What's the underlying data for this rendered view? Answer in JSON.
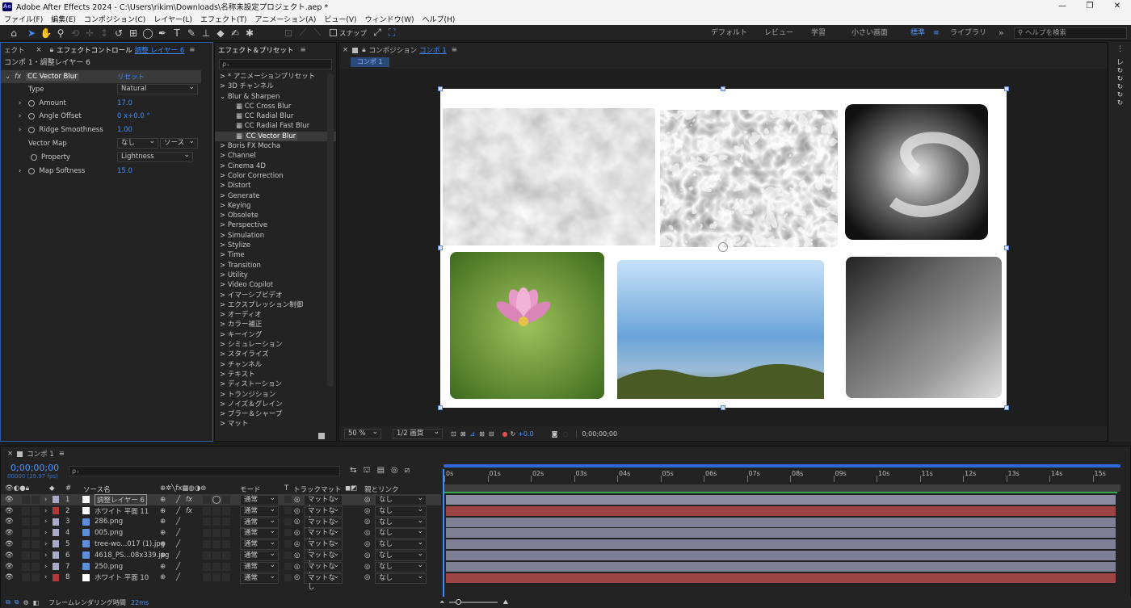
{
  "window": {
    "title": "Adobe After Effects 2024 - C:\\Users\\rikim\\Downloads\\名称未設定プロジェクト.aep *",
    "app_icon": "Ae",
    "min": "—",
    "max": "❐",
    "close": "✕"
  },
  "menu": [
    "ファイル(F)",
    "編集(E)",
    "コンポジション(C)",
    "レイヤー(L)",
    "エフェクト(T)",
    "アニメーション(A)",
    "ビュー(V)",
    "ウィンドウ(W)",
    "ヘルプ(H)"
  ],
  "toolbar": {
    "snap_label": "スナップ",
    "workspaces": [
      "デフォルト",
      "レビュー",
      "学習",
      "小さい画面",
      "標準",
      "ライブラリ"
    ],
    "active_workspace": "標準",
    "more": "»",
    "help_placeholder": "ヘルプを検索"
  },
  "effect_controls": {
    "tab_prev": "ェクト",
    "tab_label": "エフェクトコントロール",
    "tab_layer": "調整 レイヤー 6",
    "subheader": "コンポ 1・調整レイヤー 6",
    "effect_name": "CC Vector Blur",
    "reset": "リセット",
    "type_label": "Type",
    "type_value": "Natural",
    "amount_label": "Amount",
    "amount_value": "17.0",
    "angle_label": "Angle Offset",
    "angle_value": "0 x+0.0 °",
    "ridge_label": "Ridge Smoothness",
    "ridge_value": "1.00",
    "vmap_label": "Vector Map",
    "vmap_value": "なし",
    "vmap_source": "ソース",
    "property_label": "Property",
    "property_value": "Lightness",
    "softness_label": "Map Softness",
    "softness_value": "15.0"
  },
  "presets": {
    "tab_label": "エフェクト＆プリセット",
    "search_placeholder": "ρ₊",
    "items": [
      {
        "label": "> * アニメーションプリセット",
        "indent": 0
      },
      {
        "label": "> 3D チャンネル",
        "indent": 0
      },
      {
        "label": "⌄ Blur & Sharpen",
        "indent": 0
      },
      {
        "label": "CC Cross Blur",
        "indent": 1
      },
      {
        "label": "CC Radial Blur",
        "indent": 1
      },
      {
        "label": "CC Radial Fast Blur",
        "indent": 1
      },
      {
        "label": "CC Vector Blur",
        "indent": 1,
        "selected": true
      },
      {
        "label": "> Boris FX Mocha",
        "indent": 0
      },
      {
        "label": "> Channel",
        "indent": 0
      },
      {
        "label": "> Cinema 4D",
        "indent": 0
      },
      {
        "label": "> Color Correction",
        "indent": 0
      },
      {
        "label": "> Distort",
        "indent": 0
      },
      {
        "label": "> Generate",
        "indent": 0
      },
      {
        "label": "> Keying",
        "indent": 0
      },
      {
        "label": "> Obsolete",
        "indent": 0
      },
      {
        "label": "> Perspective",
        "indent": 0
      },
      {
        "label": "> Simulation",
        "indent": 0
      },
      {
        "label": "> Stylize",
        "indent": 0
      },
      {
        "label": "> Time",
        "indent": 0
      },
      {
        "label": "> Transition",
        "indent": 0
      },
      {
        "label": "> Utility",
        "indent": 0
      },
      {
        "label": "> Video Copilot",
        "indent": 0
      },
      {
        "label": "> イマーシブビデオ",
        "indent": 0
      },
      {
        "label": "> エクスプレッション制御",
        "indent": 0
      },
      {
        "label": "> オーディオ",
        "indent": 0
      },
      {
        "label": "> カラー補正",
        "indent": 0
      },
      {
        "label": "> キーイング",
        "indent": 0
      },
      {
        "label": "> シミュレーション",
        "indent": 0
      },
      {
        "label": "> スタイライズ",
        "indent": 0
      },
      {
        "label": "> チャンネル",
        "indent": 0
      },
      {
        "label": "> テキスト",
        "indent": 0
      },
      {
        "label": "> ディストーション",
        "indent": 0
      },
      {
        "label": "> トランジション",
        "indent": 0
      },
      {
        "label": "> ノイズ＆グレイン",
        "indent": 0
      },
      {
        "label": "> ブラー＆シャープ",
        "indent": 0
      },
      {
        "label": "> マット",
        "indent": 0
      }
    ]
  },
  "composition": {
    "tab_label": "コンポジション",
    "comp_name": "コンポ 1",
    "breadcrumb": "コンポ 1",
    "zoom": "50 %",
    "resolution": "1/2 画質",
    "exposure": "+0.0",
    "timecode": "0;00;00;00"
  },
  "timeline": {
    "tab_label": "コンポ 1",
    "timecode": "0;00;00;00",
    "fps": "00000 (29.97 fps)",
    "search_placeholder": "ρ₊",
    "col_source": "ソース名",
    "col_mode": "モード",
    "col_t": "T",
    "col_trackmatte": "トラックマット",
    "col_parent": "親とリンク",
    "ruler": [
      "0s",
      "01s",
      "02s",
      "03s",
      "04s",
      "05s",
      "06s",
      "07s",
      "08s",
      "09s",
      "10s",
      "11s",
      "12s",
      "13s",
      "14s",
      "15s"
    ],
    "layers": [
      {
        "num": "1",
        "name": "調整レイヤー 6",
        "mode": "通常",
        "matte": "マットなし",
        "parent": "なし",
        "label_color": "#a9a9c8",
        "icon": "adjust",
        "fx": true,
        "bar_color": "#8a8aa0"
      },
      {
        "num": "2",
        "name": "ホワイト 平面 11",
        "mode": "通常",
        "matte": "マットなし",
        "parent": "なし",
        "label_color": "#b53838",
        "icon": "solid",
        "fx": true,
        "bar_color": "#9c4444"
      },
      {
        "num": "3",
        "name": "286.png",
        "mode": "通常",
        "matte": "マットなし",
        "parent": "なし",
        "label_color": "#a9a9c8",
        "icon": "file",
        "fx": false,
        "bar_color": "#7e7e94"
      },
      {
        "num": "4",
        "name": "005.png",
        "mode": "通常",
        "matte": "マットなし",
        "parent": "なし",
        "label_color": "#a9a9c8",
        "icon": "file",
        "fx": false,
        "bar_color": "#7e7e94"
      },
      {
        "num": "5",
        "name": "tree-wo...017 (1).jpg",
        "mode": "通常",
        "matte": "マットなし",
        "parent": "なし",
        "label_color": "#a9a9c8",
        "icon": "file",
        "fx": false,
        "bar_color": "#7e7e94"
      },
      {
        "num": "6",
        "name": "4618_PS...08x339.jpg",
        "mode": "通常",
        "matte": "マットなし",
        "parent": "なし",
        "label_color": "#a9a9c8",
        "icon": "file",
        "fx": false,
        "bar_color": "#7e7e94"
      },
      {
        "num": "7",
        "name": "250.png",
        "mode": "通常",
        "matte": "マットなし",
        "parent": "なし",
        "label_color": "#a9a9c8",
        "icon": "file",
        "fx": false,
        "bar_color": "#7e7e94"
      },
      {
        "num": "8",
        "name": "ホワイト 平面 10",
        "mode": "通常",
        "matte": "マットなし",
        "parent": "なし",
        "label_color": "#b53838",
        "icon": "solid",
        "fx": false,
        "bar_color": "#9c4444"
      }
    ],
    "footer_label": "フレームレンダリング時間",
    "footer_value": "22ms"
  }
}
